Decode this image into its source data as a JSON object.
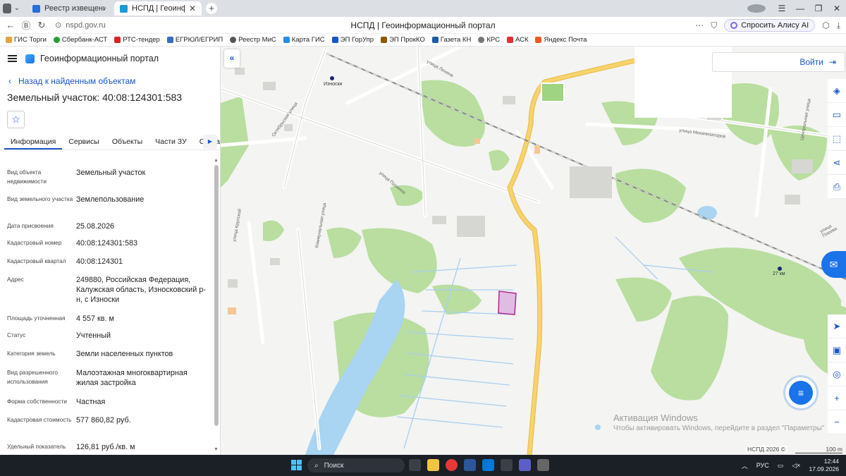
{
  "browser": {
    "tabs": [
      {
        "title": "Реестр извещений",
        "active": false
      },
      {
        "title": "НСПД | Геоинформаци",
        "active": true
      }
    ],
    "url": "nspd.gov.ru",
    "page_title": "НСПД | Геоинформационный портал",
    "alice_label": "Спросить Алису AI",
    "bookmarks": [
      "ГИС Торги",
      "Сбербанк-АСТ",
      "РТС-тендер",
      "ЕГРЮЛ/ЕГРИП",
      "Реестр МиС",
      "Карта ГИС",
      "ЭП ГорУпр",
      "ЭП ПрокКО",
      "Газета КН",
      "КРС",
      "АСК",
      "Яндекс Почта"
    ]
  },
  "panel": {
    "app_title": "Геоинформационный портал",
    "back_label": "Назад к найденным объектам",
    "object_title": "Земельный участок: 40:08:124301:583",
    "tabs": [
      "Информация",
      "Сервисы",
      "Объекты",
      "Части ЗУ",
      "Состав"
    ],
    "rows": [
      {
        "k": "Вид объекта недвижимости",
        "v": "Земельный участок"
      },
      {
        "k": "Вид земельного участка",
        "v": "Землепользование"
      },
      {
        "k": "Дата присвоения",
        "v": "25.08.2026"
      },
      {
        "k": "Кадастровый номер",
        "v": "40:08:124301:583"
      },
      {
        "k": "Кадастровый квартал",
        "v": "40:08:124301"
      },
      {
        "k": "Адрес",
        "v": "249880, Российская Федерация, Калужская область, Износковский р-н, с Износки"
      },
      {
        "k": "Площадь уточненная",
        "v": "4 557 кв. м"
      },
      {
        "k": "Статус",
        "v": "Учтенный"
      },
      {
        "k": "Категория земель",
        "v": "Земли населенных пунктов"
      },
      {
        "k": "Вид разрешенного использования",
        "v": "Малоэтажная многоквартирная жилая застройка"
      },
      {
        "k": "Форма собственности",
        "v": "Частная"
      },
      {
        "k": "Кадастровая стоимость",
        "v": "577 860,82 руб."
      },
      {
        "k": "Удельный показатель",
        "v": "126,81 руб./кв. м"
      }
    ]
  },
  "map": {
    "login_label": "Войти",
    "labels": {
      "town": "Износки",
      "km": "27 км",
      "streets": [
        "улица Пушкина",
        "Октябрьская улица",
        "улица Ленина",
        "улица Механизаторов",
        "Центральная улица",
        "улица Плеева",
        "улица Крупской",
        "Коммунальная улица"
      ]
    },
    "watermark_title": "Активация Windows",
    "watermark_text": "Чтобы активировать Windows, перейдите в раздел \"Параметры\"",
    "attribution": "НСПД 2026 ©",
    "scale": "100 m",
    "colors": {
      "forest": "#b9dea0",
      "water": "#a9d4f2",
      "parcel_fill": "#e0bce2",
      "parcel_stroke": "#b0309a",
      "road": "#f7d36b",
      "rail": "#8a8a8a"
    }
  },
  "taskbar": {
    "search_placeholder": "Поиск",
    "lang": "РУС",
    "time": "12:44",
    "date": "17.09.2026"
  }
}
